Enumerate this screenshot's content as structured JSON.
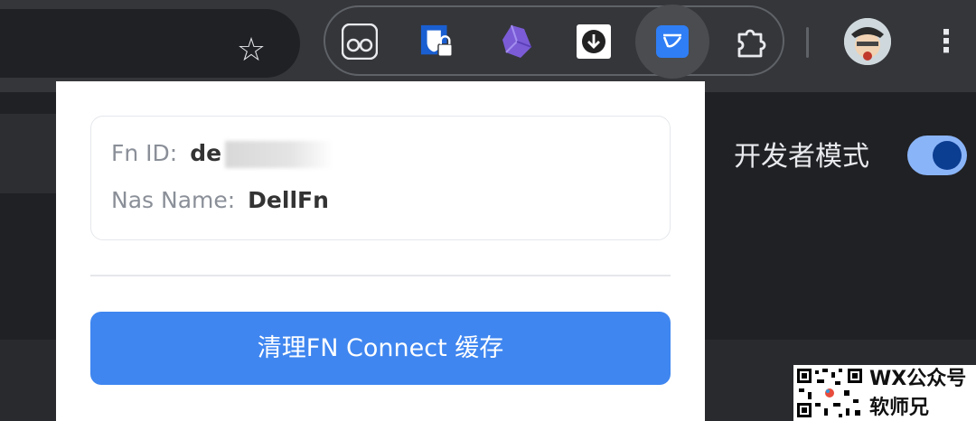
{
  "toolbar": {
    "bookmark_icon": "star-icon",
    "extensions": [
      {
        "name": "glasses-extension-icon"
      },
      {
        "name": "bitwarden-extension-icon"
      },
      {
        "name": "crystal-extension-icon"
      },
      {
        "name": "download-extension-icon"
      },
      {
        "name": "fn-connect-extension-icon"
      },
      {
        "name": "puzzle-extensions-icon"
      }
    ],
    "menu_icon": "kebab-menu-icon"
  },
  "background_page": {
    "developer_mode_label": "开发者模式",
    "developer_mode_on": true
  },
  "popup": {
    "fn_id_label": "Fn ID:",
    "fn_id_value": "de",
    "nas_name_label": "Nas Name:",
    "nas_name_value": "DellFn",
    "clear_button_label": "清理FN Connect 缓存"
  },
  "watermark": {
    "line1": "WX公众号",
    "line2": "软师兄"
  },
  "colors": {
    "accent": "#3f86f0",
    "toolbar": "#35363a",
    "page_bg": "#202124",
    "toggle": "#8ab4f8"
  }
}
